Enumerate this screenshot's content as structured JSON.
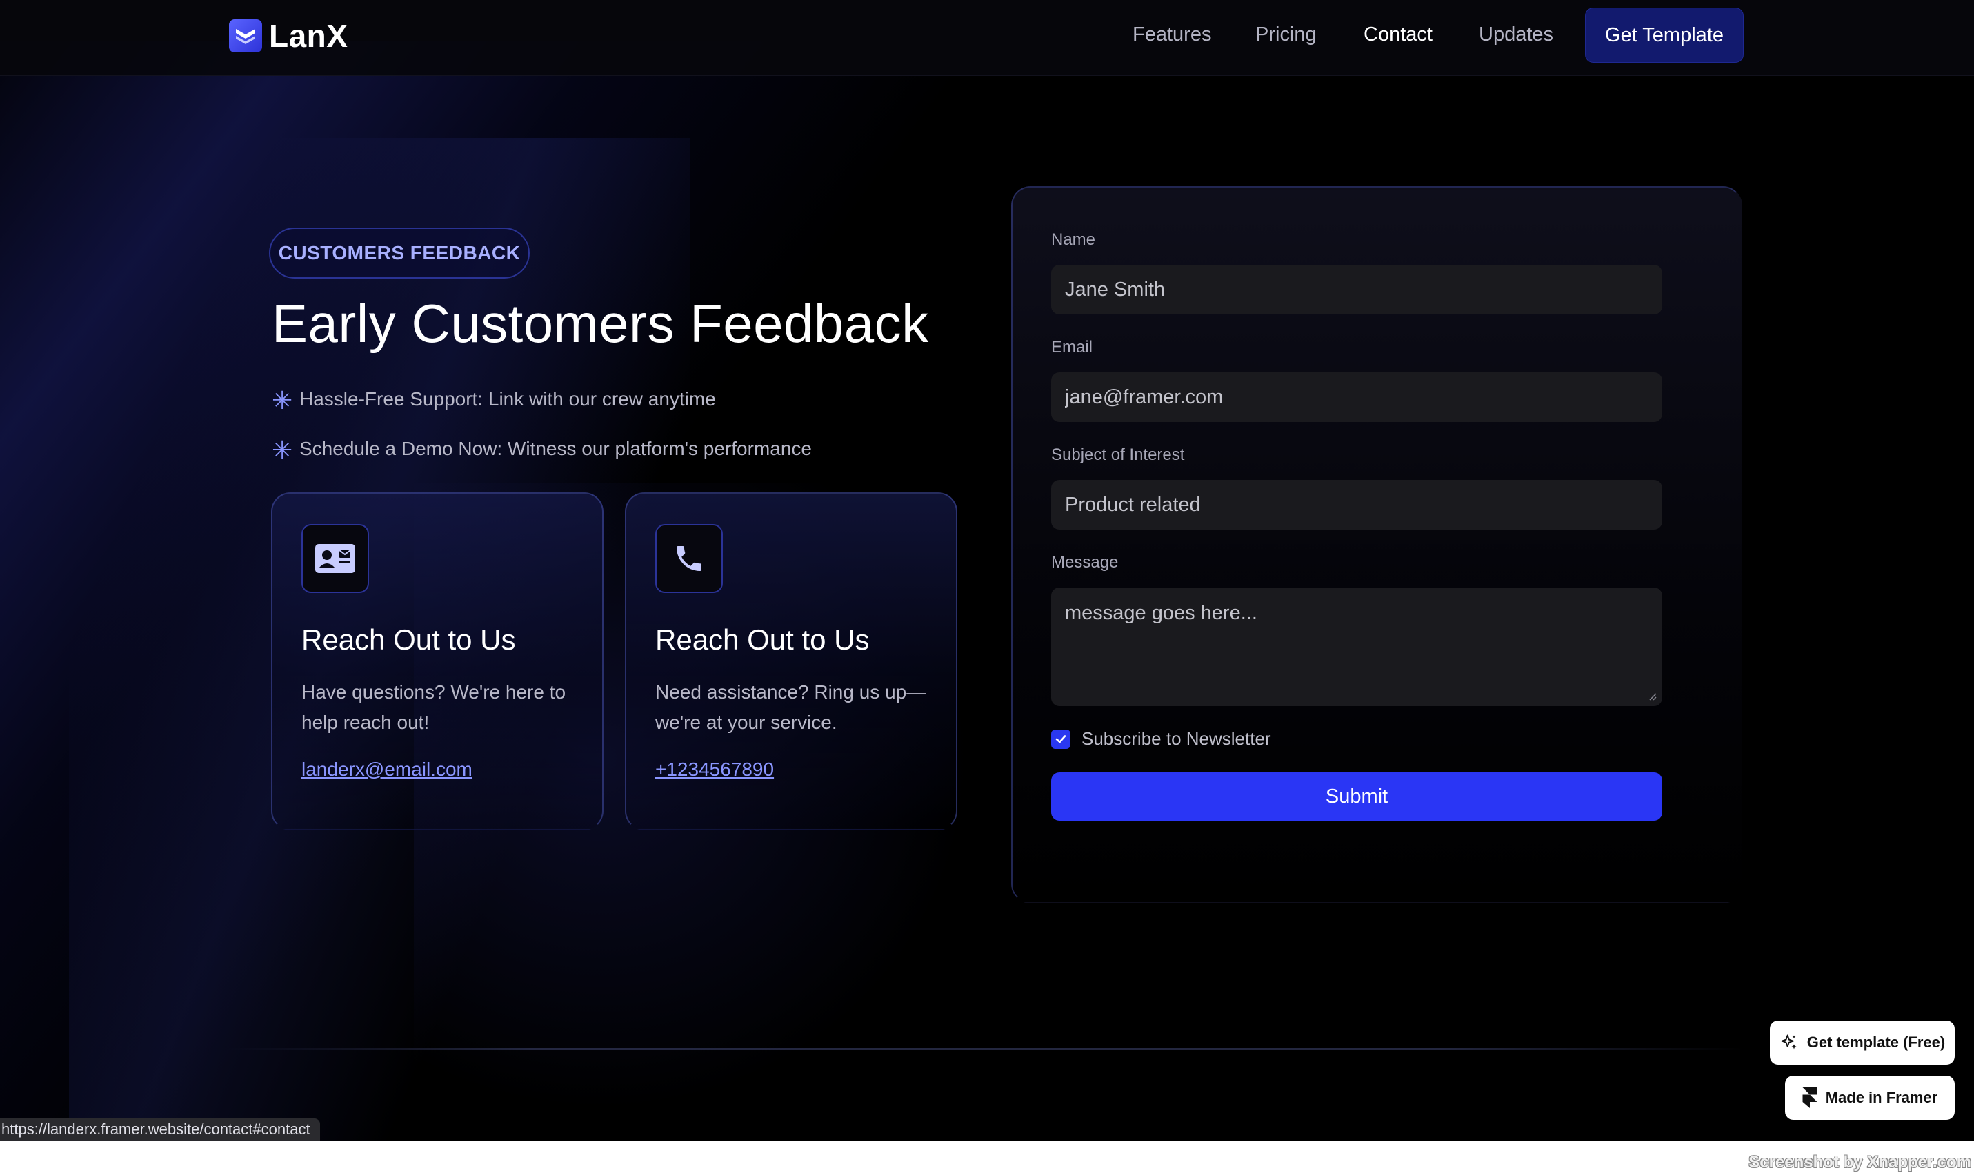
{
  "brand": {
    "name": "LanX"
  },
  "nav": {
    "links": [
      {
        "label": "Features",
        "active": false
      },
      {
        "label": "Pricing",
        "active": false
      },
      {
        "label": "Contact",
        "active": true
      },
      {
        "label": "Updates",
        "active": false
      }
    ],
    "cta_label": "Get Template"
  },
  "hero": {
    "badge": "CUSTOMERS FEEDBACK",
    "title": "Early Customers Feedback",
    "features": [
      "Hassle-Free Support: Link with our crew anytime",
      "Schedule a Demo Now: Witness our platform's performance"
    ]
  },
  "cards": [
    {
      "icon": "contact-card-icon",
      "title": "Reach Out to Us",
      "description": "Have questions? We're here to help reach out!",
      "link": "landerx@email.com"
    },
    {
      "icon": "phone-icon",
      "title": "Reach Out to Us",
      "description": "Need assistance? Ring us up—we're at your service.",
      "link": "+1234567890"
    }
  ],
  "form": {
    "name_label": "Name",
    "name_placeholder": "Jane Smith",
    "email_label": "Email",
    "email_placeholder": "jane@framer.com",
    "subject_label": "Subject of Interest",
    "subject_placeholder": "Product related",
    "message_label": "Message",
    "message_placeholder": "message goes here...",
    "newsletter_label": "Subscribe to Newsletter",
    "newsletter_checked": true,
    "submit_label": "Submit"
  },
  "framer": {
    "template_label": "Get template (Free)",
    "made_in_label": "Made in Framer"
  },
  "status_url": "https://landerx.framer.website/contact#contact",
  "watermark": "Screenshot by Xnapper.com",
  "colors": {
    "accent": "#2a36f5",
    "nav_cta_bg": "#121a6e",
    "link": "#8a96ff",
    "background": "#000000"
  }
}
